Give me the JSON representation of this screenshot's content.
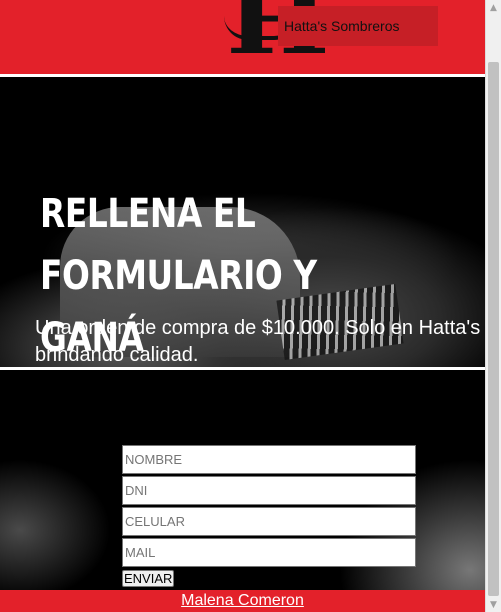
{
  "header": {
    "logo_letter": "H",
    "brand_name": "Hatta's Sombreros"
  },
  "hero": {
    "title": "RELLENA EL FORMULARIO Y GANÁ",
    "subtitle": "Una orden de compra de $10.000. Solo en Hatta's brindando calidad."
  },
  "form": {
    "fields": [
      {
        "placeholder": "NOMBRE",
        "value": ""
      },
      {
        "placeholder": "DNI",
        "value": ""
      },
      {
        "placeholder": "CELULAR",
        "value": ""
      },
      {
        "placeholder": "MAIL",
        "value": ""
      }
    ],
    "submit_label": "ENVIAR"
  },
  "footer": {
    "author_link": "Malena Comeron"
  },
  "colors": {
    "brand_red": "#e3212a",
    "brand_dark_red": "#c61f26"
  }
}
